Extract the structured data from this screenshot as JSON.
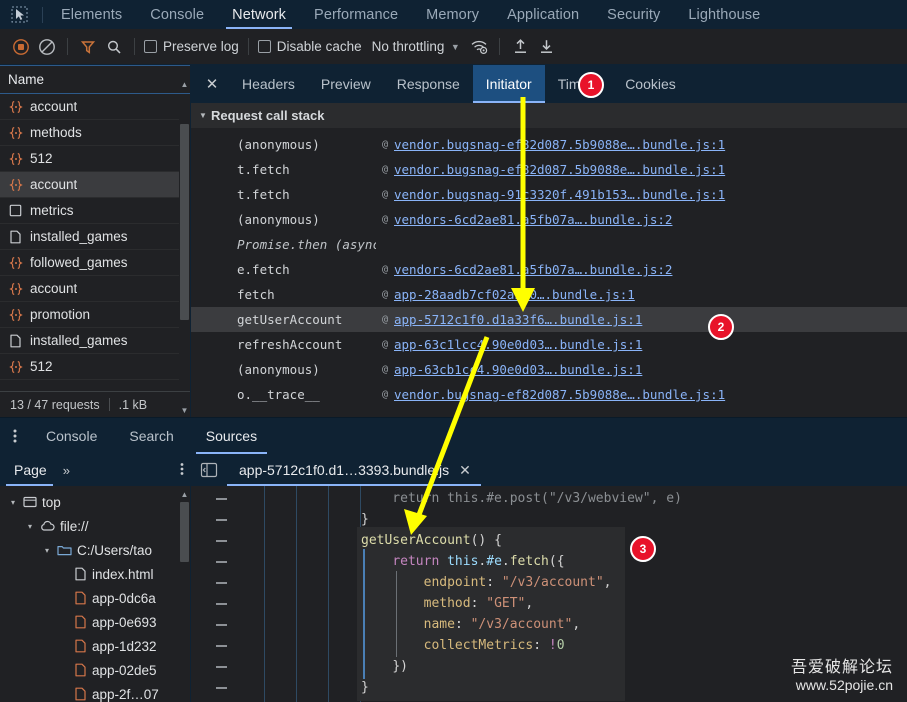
{
  "devtools": {
    "inspect_icon": "inspect-cursor-icon",
    "tabs": [
      {
        "label": "Elements",
        "active": false
      },
      {
        "label": "Console",
        "active": false
      },
      {
        "label": "Network",
        "active": true
      },
      {
        "label": "Performance",
        "active": false
      },
      {
        "label": "Memory",
        "active": false
      },
      {
        "label": "Application",
        "active": false
      },
      {
        "label": "Security",
        "active": false
      },
      {
        "label": "Lighthouse",
        "active": false
      }
    ]
  },
  "network_toolbar": {
    "record_icon": "record-stop-icon",
    "clear_icon": "clear-circle-slash-icon",
    "filter_icon": "filter-funnel-icon",
    "search_icon": "search-magnifier-icon",
    "preserve_log_label": "Preserve log",
    "disable_cache_label": "Disable cache",
    "throttling_value": "No throttling",
    "throttle_caret_icon": "chevron-down-icon",
    "wifi_icon": "network-conditions-wifi-icon",
    "import_icon": "import-har-upload-icon",
    "export_icon": "export-har-download-icon"
  },
  "request_list": {
    "column_header": "Name",
    "rows": [
      {
        "name": "account",
        "icon": "json-braces-icon",
        "selected": false
      },
      {
        "name": "methods",
        "icon": "json-braces-icon",
        "selected": false
      },
      {
        "name": "512",
        "icon": "json-braces-icon",
        "selected": false
      },
      {
        "name": "account",
        "icon": "json-braces-icon",
        "selected": true
      },
      {
        "name": "metrics",
        "icon": "square-doc-icon",
        "selected": false
      },
      {
        "name": "installed_games",
        "icon": "document-icon",
        "selected": false
      },
      {
        "name": "followed_games",
        "icon": "json-braces-icon",
        "selected": false
      },
      {
        "name": "account",
        "icon": "json-braces-icon",
        "selected": false
      },
      {
        "name": "promotion",
        "icon": "json-braces-icon",
        "selected": false
      },
      {
        "name": "installed_games",
        "icon": "document-icon",
        "selected": false
      },
      {
        "name": "512",
        "icon": "json-braces-icon",
        "selected": false
      }
    ],
    "status_requests": "13 / 47 requests",
    "status_size": ".1 kB"
  },
  "request_detail": {
    "close_icon": "close-x-icon",
    "tabs": [
      {
        "label": "Headers",
        "active": false
      },
      {
        "label": "Preview",
        "active": false
      },
      {
        "label": "Response",
        "active": false
      },
      {
        "label": "Initiator",
        "active": true
      },
      {
        "label": "Timing",
        "active": false
      },
      {
        "label": "Cookies",
        "active": false
      }
    ],
    "section_title": "Request call stack",
    "section_caret_icon": "triangle-down-icon",
    "call_stack": [
      {
        "fn": "(anonymous)",
        "at": "@",
        "link": "vendor.bugsnag-ef82d087.5b9088e….bundle.js:1",
        "selected": false,
        "async": false
      },
      {
        "fn": "t.fetch",
        "at": "@",
        "link": "vendor.bugsnag-ef82d087.5b9088e….bundle.js:1",
        "selected": false,
        "async": false
      },
      {
        "fn": "t.fetch",
        "at": "@",
        "link": "vendor.bugsnag-91c3320f.491b153….bundle.js:1",
        "selected": false,
        "async": false
      },
      {
        "fn": "(anonymous)",
        "at": "@",
        "link": "vendors-6cd2ae81.a5fb07a….bundle.js:2",
        "selected": false,
        "async": false
      },
      {
        "fn": "Promise.then (async)",
        "at": "",
        "link": "",
        "selected": false,
        "async": true
      },
      {
        "fn": "e.fetch",
        "at": "@",
        "link": "vendors-6cd2ae81.a5fb07a….bundle.js:2",
        "selected": false,
        "async": false
      },
      {
        "fn": "fetch",
        "at": "@",
        "link": "app-28aadb7cf02ab00….bundle.js:1",
        "selected": false,
        "async": false
      },
      {
        "fn": "getUserAccount",
        "at": "@",
        "link": "app-5712c1f0.d1a33f6….bundle.js:1",
        "selected": true,
        "async": false
      },
      {
        "fn": "refreshAccount",
        "at": "@",
        "link": "app-63c1lcc4.90e0d03….bundle.js:1",
        "selected": false,
        "async": false
      },
      {
        "fn": "(anonymous)",
        "at": "@",
        "link": "app-63cb1cc4.90e0d03….bundle.js:1",
        "selected": false,
        "async": false
      },
      {
        "fn": "o.__trace__",
        "at": "@",
        "link": "vendor.bugsnag-ef82d087.5b9088e….bundle.js:1",
        "selected": false,
        "async": false
      }
    ]
  },
  "drawer": {
    "kebab_icon": "more-vertical-icon",
    "tabs": [
      {
        "label": "Console",
        "active": false
      },
      {
        "label": "Search",
        "active": false
      },
      {
        "label": "Sources",
        "active": true
      }
    ]
  },
  "sources_nav": {
    "page_tab": "Page",
    "more_icon": "chevrons-right-icon",
    "kebab_icon": "more-vertical-icon",
    "tree": [
      {
        "label": "top",
        "icon": "browser-window-icon",
        "depth": 0,
        "twisty": "▾"
      },
      {
        "label": "file://",
        "icon": "cloud-icon",
        "depth": 1,
        "twisty": "▾"
      },
      {
        "label": "C:/Users/tao",
        "icon": "folder-icon",
        "depth": 2,
        "twisty": "▾"
      },
      {
        "label": "index.html",
        "icon": "document-icon",
        "depth": 3,
        "twisty": ""
      },
      {
        "label": "app-0dc6a",
        "icon": "js-file-icon",
        "depth": 3,
        "twisty": ""
      },
      {
        "label": "app-0e693",
        "icon": "js-file-icon",
        "depth": 3,
        "twisty": ""
      },
      {
        "label": "app-1d232",
        "icon": "js-file-icon",
        "depth": 3,
        "twisty": ""
      },
      {
        "label": "app-02de5",
        "icon": "js-file-icon",
        "depth": 3,
        "twisty": ""
      },
      {
        "label": "app-2f…07",
        "icon": "js-file-icon",
        "depth": 3,
        "twisty": ""
      }
    ]
  },
  "editor": {
    "panel_toggle_icon": "show-navigator-panel-icon",
    "tab_label": "app-5712c1f0.d1…3393.bundle.js",
    "tab_close_icon": "close-x-icon",
    "code_lines": [
      "    return this.#e.post(\"/v3/webview\", e)",
      "}",
      "getUserAccount() {",
      "    return this.#e.fetch({",
      "        endpoint: \"/v3/account\",",
      "        method: \"GET\",",
      "        name: \"/v3/account\",",
      "        collectMetrics: !0",
      "    })",
      "}"
    ],
    "gutter_marker": "—"
  },
  "annotations": [
    {
      "number": "1",
      "target": "initiator-tab"
    },
    {
      "number": "2",
      "target": "get-user-account-stack-row"
    },
    {
      "number": "3",
      "target": "get-user-account-source-block"
    }
  ],
  "watermark": {
    "line1": "吾爱破解论坛",
    "line2": "www.52pojie.cn"
  },
  "colors": {
    "accent_blue": "#8ab4f8",
    "tabbar_bg": "#0f2233",
    "panel_bg": "#202124",
    "annotation_red": "#e8132a",
    "arrow_yellow": "#ffff00",
    "json_icon_orange": "#d4764a"
  }
}
